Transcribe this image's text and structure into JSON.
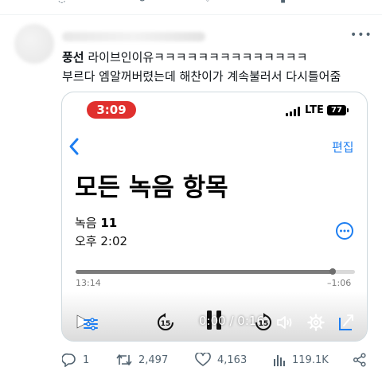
{
  "tweet": {
    "author_name_blurred": true,
    "text_line1_bold": "풍선",
    "text_line1_rest": " 라이브인이유ㅋㅋㅋㅋㅋㅋㅋㅋㅋㅋㅋㅋㅋㅋ",
    "text_line2": "부르다 엠알꺼버렸는데 해찬이가 계속불러서 다시틀어줌"
  },
  "media": {
    "status_time": "3:09",
    "network": "LTE",
    "battery": "77",
    "edit_label": "편집",
    "title": "모든 녹음 항목",
    "recording_name_prefix": "녹음 ",
    "recording_number": "11",
    "recording_time": "오후 2:02",
    "elapsed": "13:14",
    "remaining": "–1:06",
    "progress_fraction": 0.92,
    "video_time": "0:00 / 0:16"
  },
  "actions": {
    "replies": "1",
    "retweets": "2,497",
    "likes": "4,163",
    "views": "119.1K"
  },
  "colors": {
    "accent": "#1d7ef1",
    "status_red": "#e0302e",
    "muted": "#536471"
  }
}
